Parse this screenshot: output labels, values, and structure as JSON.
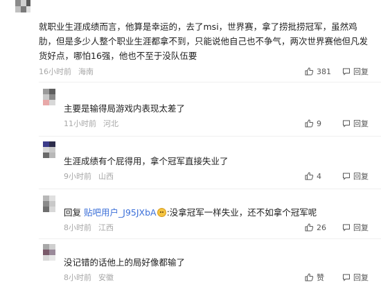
{
  "top_comment": {
    "text": "就职业生涯成绩而言，他算是幸运的，去了msi，世界赛，拿了捞批捞冠军，虽然鸡肋，但是多少人整个职业生涯都拿不到，只能说他自己也不争气，两次世界赛他但凡发货好点，哪怕16强，他也不至于没队伍要",
    "time": "16小时前",
    "location": "海南",
    "likes": "381",
    "reply_label": "回复"
  },
  "replies": [
    {
      "text": "主要是输得局游戏内表现太差了",
      "time": "11小时前",
      "location": "河北",
      "likes": "9",
      "reply_label": "回复",
      "avatar_colors": [
        "#9a9a9a",
        "#5e5e5e",
        "#c9c9c9",
        "#8a8a8a",
        "#e8a8a8",
        "#d8d8d8"
      ]
    },
    {
      "text": "生涯成绩有个屁得用，拿个冠军直接失业了",
      "time": "9小时前",
      "location": "山西",
      "likes": "4",
      "reply_label": "回复",
      "avatar_colors": [
        "#3c3c8a",
        "#2c2c4a",
        "#d8d8d8",
        "#c8c8c8",
        "#6a6a6a",
        "#b8b8b8"
      ]
    },
    {
      "prefix": "回复",
      "user": "贴吧用户_J95JXbA",
      "text_after": ":没拿冠军一样失业，还不如拿个冠军呢",
      "time": "8小时前",
      "location": "江西",
      "likes": "26",
      "reply_label": "回复",
      "avatar_colors": [
        "#b8b8b8",
        "#e0e0e0",
        "#8a8a8a",
        "#c8c8c8",
        "#6e6e6e",
        "#d8d8d8"
      ]
    },
    {
      "text": "没记错的话他上的局好像都输了",
      "time": "8小时前",
      "location": "安徽",
      "likes": "赞",
      "reply_label": "回复",
      "avatar_colors": [
        "#a8a8a8",
        "#cfcfcf",
        "#7a5a6a",
        "#9a8a9a",
        "#d8d8d8",
        "#e8e8e8"
      ]
    }
  ],
  "colors": {
    "username_link": "#3b6fd8",
    "meta_gray": "#a7a7a7"
  }
}
